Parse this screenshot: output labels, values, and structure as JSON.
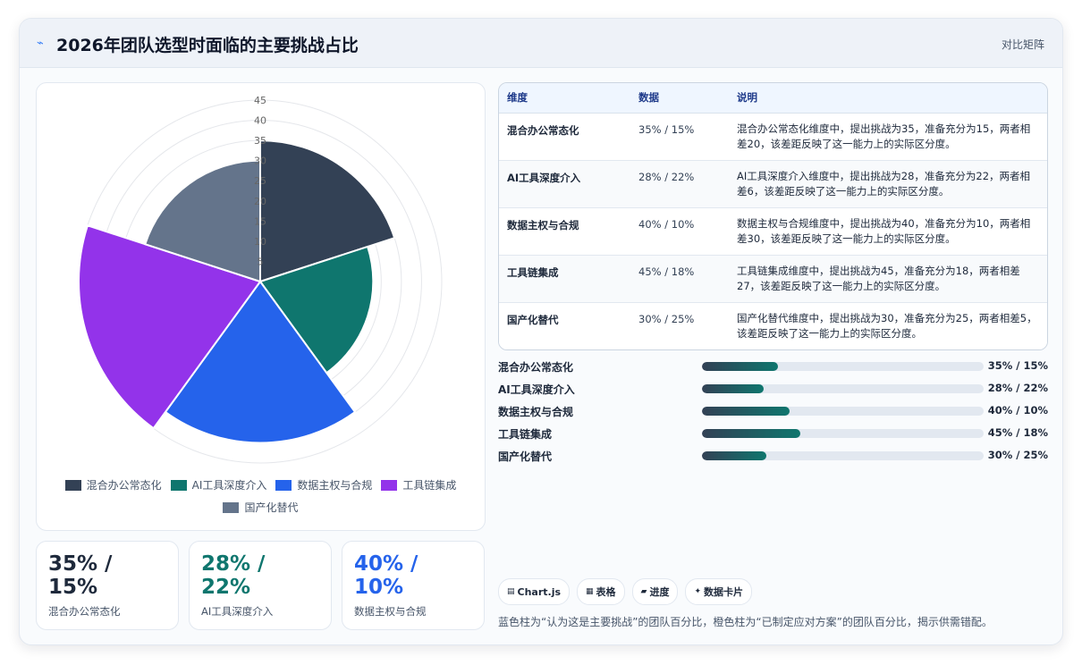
{
  "header": {
    "icon": "pulse-icon",
    "title": "2026年团队选型时面临的主要挑战占比",
    "tag": "对比矩阵"
  },
  "colors": {
    "series": [
      "#334155",
      "#0f766e",
      "#2563eb",
      "#9333ea",
      "#64748b"
    ],
    "accent": "#0f766e"
  },
  "chart_data": {
    "type": "polarArea",
    "categories": [
      "混合办公常态化",
      "AI工具深度介入",
      "数据主权与合规",
      "工具链集成",
      "国产化替代"
    ],
    "values": [
      35,
      28,
      40,
      45,
      30
    ],
    "r_ticks": [
      5,
      10,
      15,
      20,
      25,
      30,
      35,
      40,
      45
    ],
    "r_range": [
      0,
      45
    ],
    "legend_position": "bottom"
  },
  "stats": [
    {
      "value": "35% / 15%",
      "label": "混合办公常态化"
    },
    {
      "value": "28% / 22%",
      "label": "AI工具深度介入"
    },
    {
      "value": "40% / 10%",
      "label": "数据主权与合规"
    }
  ],
  "table": {
    "headers": [
      "维度",
      "数据",
      "说明"
    ],
    "rows": [
      [
        "混合办公常态化",
        "35% / 15%",
        "混合办公常态化维度中，提出挑战为35，准备充分为15，两者相差20，该差距反映了这一能力上的实际区分度。"
      ],
      [
        "AI工具深度介入",
        "28% / 22%",
        "AI工具深度介入维度中，提出挑战为28，准备充分为22，两者相差6，该差距反映了这一能力上的实际区分度。"
      ],
      [
        "数据主权与合规",
        "40% / 10%",
        "数据主权与合规维度中，提出挑战为40，准备充分为10，两者相差30，该差距反映了这一能力上的实际区分度。"
      ],
      [
        "工具链集成",
        "45% / 18%",
        "工具链集成维度中，提出挑战为45，准备充分为18，两者相差27，该差距反映了这一能力上的实际区分度。"
      ],
      [
        "国产化替代",
        "30% / 25%",
        "国产化替代维度中，提出挑战为30，准备充分为25，两者相差5，该差距反映了这一能力上的实际区分度。"
      ]
    ]
  },
  "progress": [
    {
      "label": "混合办公常态化",
      "value": "35% / 15%",
      "fraction": 0.27
    },
    {
      "label": "AI工具深度介入",
      "value": "28% / 22%",
      "fraction": 0.22
    },
    {
      "label": "数据主权与合规",
      "value": "40% / 10%",
      "fraction": 0.31
    },
    {
      "label": "工具链集成",
      "value": "45% / 18%",
      "fraction": 0.35
    },
    {
      "label": "国产化替代",
      "value": "30% / 25%",
      "fraction": 0.23
    }
  ],
  "chips": [
    {
      "icon": "chart-icon",
      "glyph": "▤",
      "label": "Chart.js"
    },
    {
      "icon": "table-icon",
      "glyph": "▦",
      "label": "表格"
    },
    {
      "icon": "progress-icon",
      "glyph": "▰",
      "label": "进度"
    },
    {
      "icon": "card-icon",
      "glyph": "✦",
      "label": "数据卡片"
    }
  ],
  "footnote": "蓝色柱为“认为这是主要挑战”的团队百分比，橙色柱为“已制定应对方案”的团队百分比，揭示供需错配。"
}
